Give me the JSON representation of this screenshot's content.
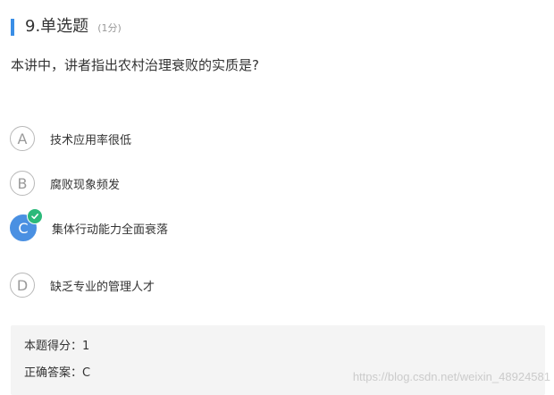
{
  "question": {
    "title": "9.单选题",
    "score": "(1分)",
    "stem": "本讲中，讲者指出农村治理衰败的实质是?"
  },
  "options": [
    {
      "letter": "A",
      "text": "技术应用率很低",
      "selected": false
    },
    {
      "letter": "B",
      "text": "腐败现象频发",
      "selected": false
    },
    {
      "letter": "C",
      "text": "集体行动能力全面衰落",
      "selected": true
    },
    {
      "letter": "D",
      "text": "缺乏专业的管理人才",
      "selected": false
    }
  ],
  "result": {
    "score_label": "本题得分：",
    "score_value": "1",
    "answer_label": "正确答案：",
    "answer_value": "C"
  },
  "watermark": "https://blog.csdn.net/weixin_48924581",
  "colors": {
    "accent": "#3a8ee6",
    "selected": "#4a90e2",
    "check": "#2bb97a"
  }
}
